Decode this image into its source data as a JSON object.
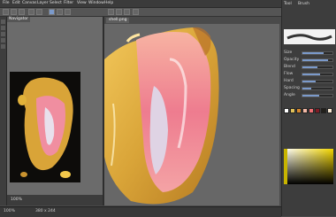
{
  "menubar": {
    "items": [
      "File",
      "Edit",
      "Canvas",
      "Layer",
      "Select",
      "Filter",
      "View",
      "Window",
      "Help"
    ]
  },
  "toolbar": {
    "icons": [
      "new-icon",
      "open-icon",
      "save-icon",
      "undo-icon",
      "redo-icon",
      "brush-icon",
      "eraser-icon",
      "move-icon",
      "zoom-icon",
      "rotate-icon",
      "flip-icon",
      "settings-icon"
    ]
  },
  "navigator": {
    "tab_label": "Navigator",
    "zoom_text": "100%"
  },
  "canvas": {
    "tabs": [
      "shell.png"
    ]
  },
  "right_panel": {
    "tabs": [
      "Tool",
      "Brush"
    ],
    "properties": [
      {
        "label": "Size",
        "value": 0.7
      },
      {
        "label": "Opacity",
        "value": 0.85
      },
      {
        "label": "Blend",
        "value": 0.5
      },
      {
        "label": "Flow",
        "value": 0.6
      },
      {
        "label": "Hard",
        "value": 0.45
      },
      {
        "label": "Spacing",
        "value": 0.3
      },
      {
        "label": "Angle",
        "value": 0.55
      }
    ],
    "swatches": [
      "#ffffff",
      "#e0c15a",
      "#d4872e",
      "#f3b9a6",
      "#ef6f73",
      "#7d1d26",
      "#22201b",
      "#f6e7d1"
    ]
  },
  "status": {
    "left": "100%",
    "middle": "380 x 244"
  },
  "colors": {
    "accent": "#7b9acb",
    "shell_gold": "#d9a438",
    "shell_pink": "#f08ea0"
  }
}
